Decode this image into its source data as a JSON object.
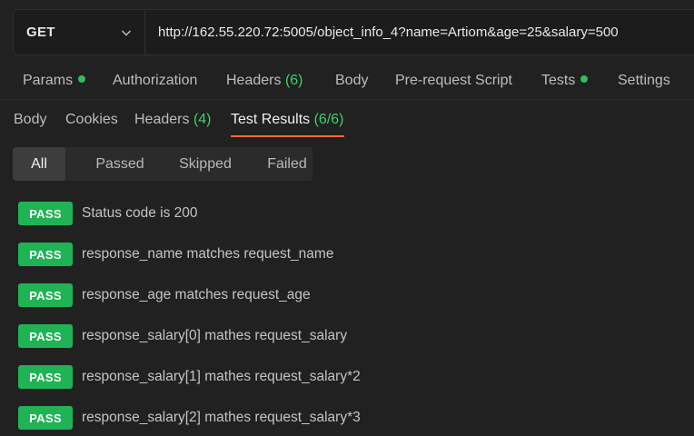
{
  "request": {
    "method": "GET",
    "url": "http://162.55.220.72:5005/object_info_4?name=Artiom&age=25&salary=500"
  },
  "request_tabs": {
    "params": "Params",
    "authorization": "Authorization",
    "headers": "Headers",
    "headers_count": "(6)",
    "body": "Body",
    "pre_request": "Pre-request Script",
    "tests": "Tests",
    "settings": "Settings"
  },
  "response_tabs": {
    "body": "Body",
    "cookies": "Cookies",
    "headers": "Headers",
    "headers_count": "(4)",
    "test_results": "Test Results",
    "test_results_count": "(6/6)"
  },
  "filters": {
    "all": "All",
    "passed": "Passed",
    "skipped": "Skipped",
    "failed": "Failed",
    "selected": "All"
  },
  "colors": {
    "pass_green": "#1fb356",
    "active_tab_underline": "#ff6c37",
    "count_green": "#3ecf6e"
  },
  "tests": [
    {
      "status": "PASS",
      "name": "Status code is 200"
    },
    {
      "status": "PASS",
      "name": "response_name matches request_name"
    },
    {
      "status": "PASS",
      "name": "response_age matches request_age"
    },
    {
      "status": "PASS",
      "name": "response_salary[0] mathes request_salary"
    },
    {
      "status": "PASS",
      "name": "response_salary[1] mathes request_salary*2"
    },
    {
      "status": "PASS",
      "name": "response_salary[2] mathes request_salary*3"
    }
  ]
}
